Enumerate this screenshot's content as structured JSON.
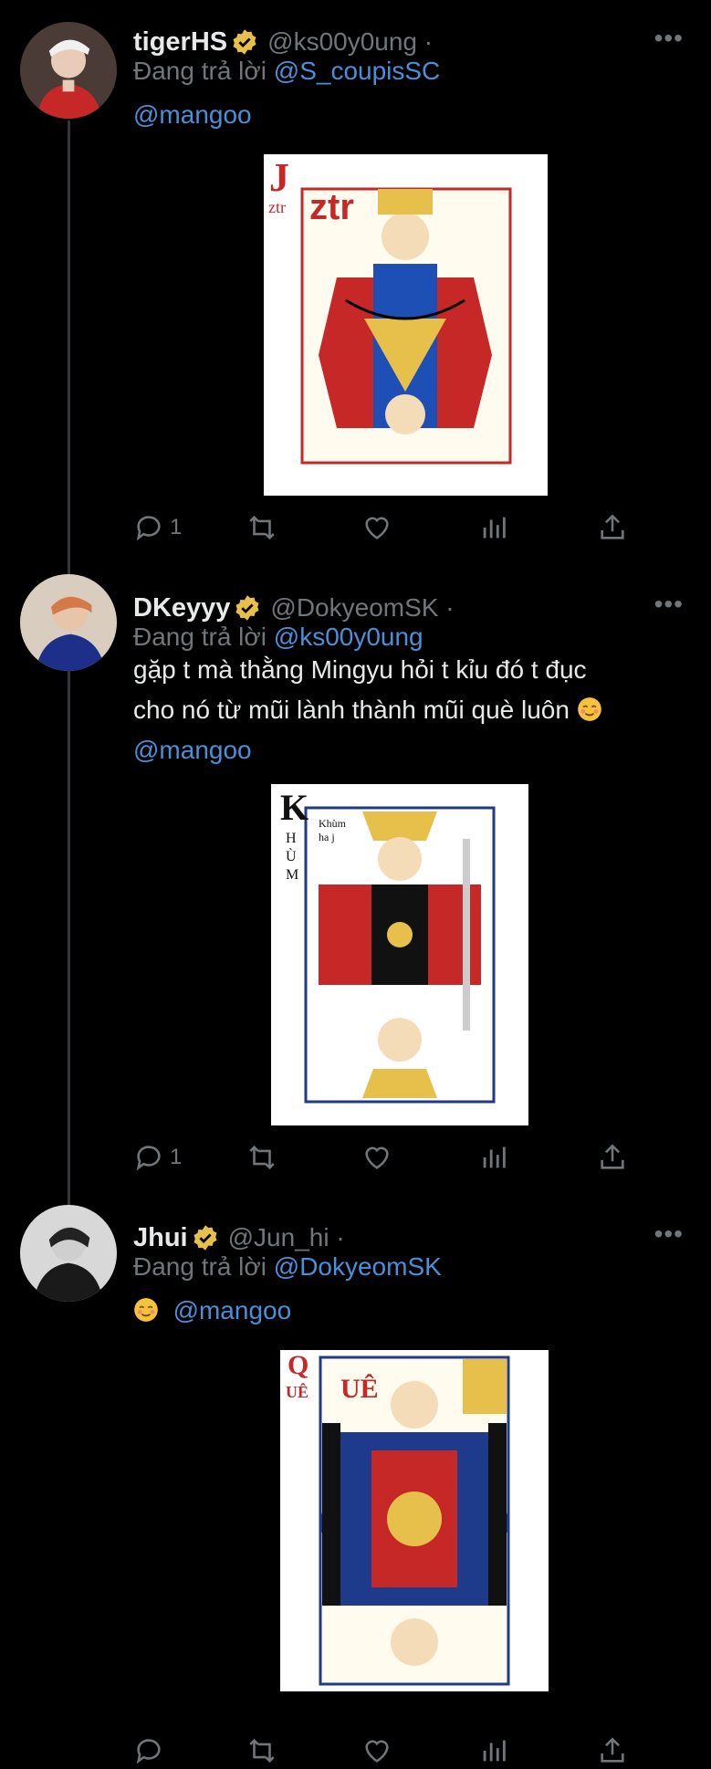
{
  "tweets": [
    {
      "name": "tigerHS",
      "handle": "@ks00y0ung ·",
      "reply_prefix": "Đang trả lời",
      "reply_to": "@S_coupisSC",
      "mention": "@mangoo",
      "card": {
        "rank": "J",
        "corner_text": "ztr",
        "center_text": "ztr"
      },
      "reply_count": "1"
    },
    {
      "name": "DKeyyy",
      "handle": "@DokyeomSK ·",
      "reply_prefix": "Đang trả lời",
      "reply_to": "@ks00y0ung",
      "text_line1": "gặp t mà thằng Mingyu hỏi t kỉu đó t đục",
      "text_line2": "cho nó từ mũi lành thành mũi què luôn",
      "mention": "@mangoo",
      "card": {
        "rank": "K",
        "corner_text": "HÙM",
        "caption": "Khùm ha j"
      },
      "reply_count": "1"
    },
    {
      "name": "Jhui",
      "handle": "@Jun_hi ·",
      "reply_prefix": "Đang trả lời",
      "reply_to": "@DokyeomSK",
      "mention": "@mangoo",
      "card": {
        "rank": "Q",
        "corner_text": "UÊ",
        "center_text": "UÊ"
      },
      "reply_count": ""
    }
  ],
  "more_label": "•••",
  "colors": {
    "link": "#4a90d9",
    "muted": "#71767b",
    "verified": "#e7c04b"
  }
}
